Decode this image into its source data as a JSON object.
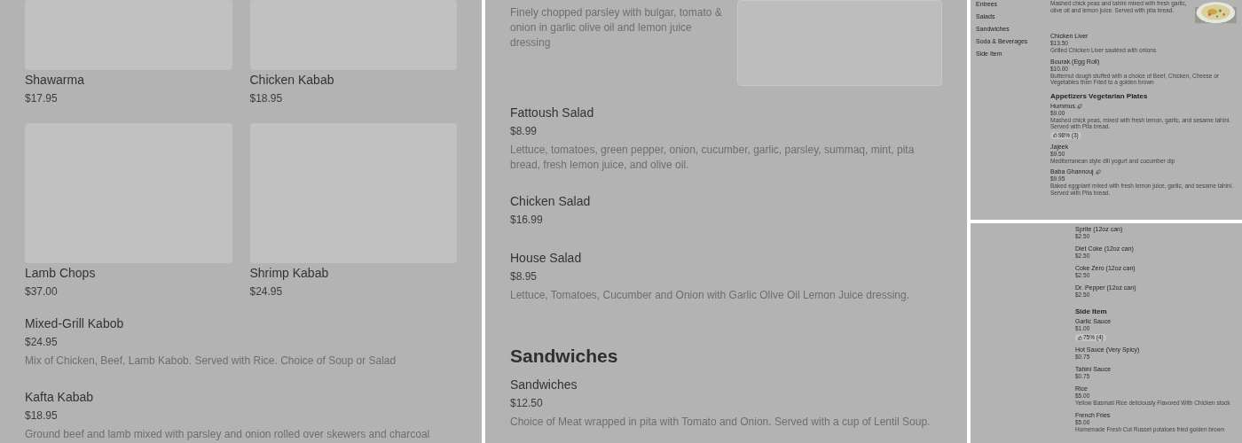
{
  "grid_page": {
    "tiles": [
      {
        "name": "Shawarma",
        "price": "$17.95"
      },
      {
        "name": "Chicken Kabab",
        "price": "$18.95"
      },
      {
        "name": "Lamb Chops",
        "price": "$37.00"
      },
      {
        "name": "Shrimp Kabab",
        "price": "$24.95"
      }
    ],
    "items": [
      {
        "name": "Mixed-Grill Kabob",
        "price": "$24.95",
        "description": "Mix of Chicken, Beef, Lamb Kabob. Served with Rice. Choice of Soup or Salad"
      },
      {
        "name": "Kafta Kabab",
        "price": "$18.95",
        "description": "Ground beef and lamb mixed with parsley and onion rolled over skewers and charcoal"
      }
    ]
  },
  "salad_page": {
    "partial_description": "Finely chopped parsley with bulgar, tomato & onion in garlic olive oil and lemon juice dressing",
    "items": [
      {
        "name": "Fattoush Salad",
        "price": "$8.99",
        "description": "Lettuce, tomatoes, green pepper, onion, cucumber, garlic, parsley, summaq, mint, pita bread, fresh lemon juice, and olive oil."
      },
      {
        "name": "Chicken Salad",
        "price": "$16.99"
      },
      {
        "name": "House Salad",
        "price": "$8.95",
        "description": "Lettuce, Tomatoes, Cucumber and Onion with Garlic Olive Oil Lemon Juice dressing."
      }
    ],
    "section": {
      "title": "Sandwiches",
      "items": [
        {
          "name": "Sandwiches",
          "price": "$12.50",
          "description": "Choice of Meat wrapped in pita with Tomato and Onion. Served with a cup of Lentil Soup."
        }
      ]
    }
  },
  "mobile_menu_top": {
    "categories": [
      "Entrees",
      "Salads",
      "Sandwiches",
      "Soda & Beverages",
      "Side Item"
    ],
    "partial_description": "Mashed chick peas and tahini mixed with fresh garlic, olive oil and lemon juice. Served with pita bread.",
    "items": [
      {
        "name": "Chicken Liver",
        "price": "$13.50",
        "description": "Grilled Chicken Liver sautéed with onions"
      },
      {
        "name": "Bourak (Egg Roll)",
        "price": "$10.00",
        "description": "Butternut dough stuffed with a choice of Beef, Chicken, Cheese or Vegetables then Fried to a golden brown"
      }
    ],
    "section": {
      "title": "Appetizers Vegetarian Plates",
      "items": [
        {
          "name": "Hummus",
          "vegetarian": true,
          "price": "$9.00",
          "description": "Mashed chick peas, mixed with fresh lemon, garlic, and sesame tahini. Served with Pita bread.",
          "rating": "98% (3)"
        },
        {
          "name": "Jajeek",
          "vegetarian": false,
          "price": "$9.50",
          "description": "Mediterranean style dill yogurt and cucumber dip"
        },
        {
          "name": "Baba Ghannouj",
          "vegetarian": true,
          "price": "$9.95",
          "description": "Baked eggplant mixed with fresh lemon juice, garlic, and sesame tahini. Served with Pita bread."
        }
      ]
    }
  },
  "mobile_menu_bottom": {
    "items": [
      {
        "name": "Sprite (12oz can)",
        "price": "$2.50"
      },
      {
        "name": "Diet Coke (12oz can)",
        "price": "$2.50"
      },
      {
        "name": "Coke Zero (12oz can)",
        "price": "$2.50"
      },
      {
        "name": "Dr. Pepper (12oz can)",
        "price": "$2.50"
      }
    ],
    "section": {
      "title": "Side Item",
      "items": [
        {
          "name": "Garlic Sauce",
          "price": "$1.00",
          "rating": "75% (4)"
        },
        {
          "name": "Hot Sauce (Very Spicy)",
          "price": "$0.75"
        },
        {
          "name": "Tahini Sauce",
          "price": "$0.75"
        },
        {
          "name": "Rice",
          "price": "$5.00",
          "description": "Yellow Basmati Rice deliciously Flavored With Chicken stock"
        },
        {
          "name": "French Fries",
          "price": "$5.00",
          "description": "Homemade Fresh Cut Russet potatoes fried golden brown"
        }
      ]
    }
  }
}
